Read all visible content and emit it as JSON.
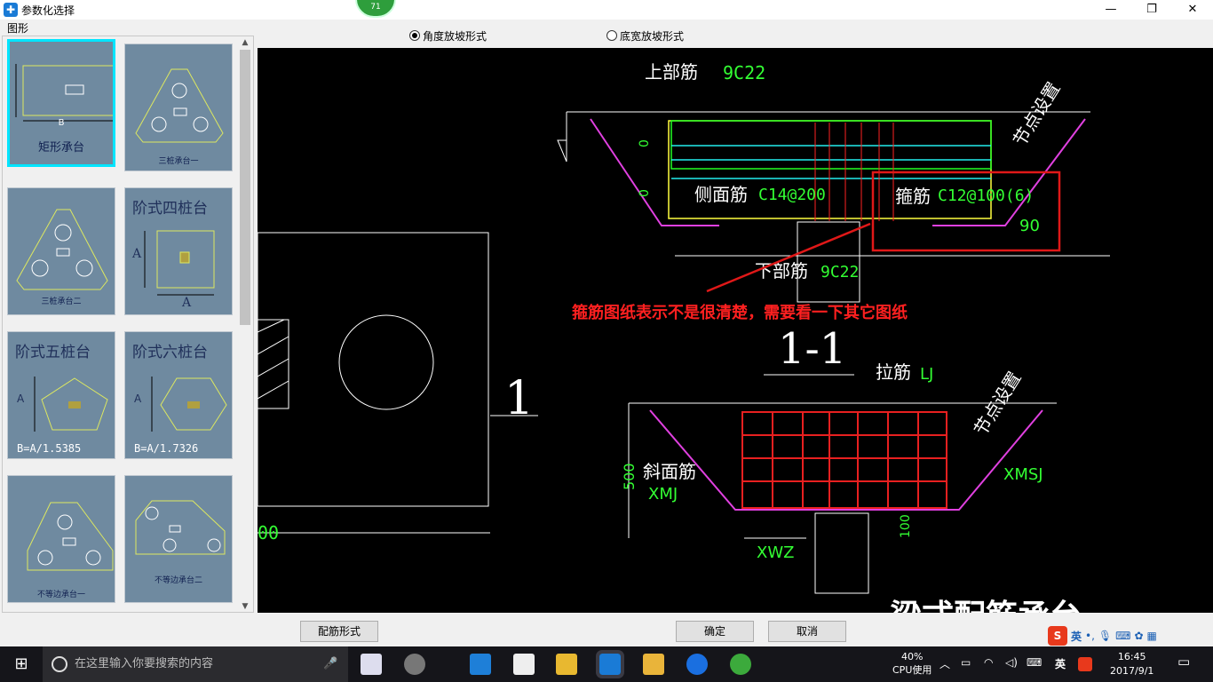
{
  "window": {
    "title": "参数化选择",
    "badge": "71",
    "minimize": "—",
    "maximize": "❐",
    "close": "✕"
  },
  "left_panel": {
    "label": "图形",
    "items": [
      {
        "caption": "矩形承台",
        "dim": "B"
      },
      {
        "caption": "三桩承台一"
      },
      {
        "caption": "三桩承台二"
      },
      {
        "caption": "阶式四桩台",
        "dim": "A",
        "dim2": "A"
      },
      {
        "caption": "阶式五桩台",
        "dim": "A",
        "formula": "B=A/1.5385"
      },
      {
        "caption": "阶式六桩台",
        "dim": "A",
        "formula": "B=A/1.7326"
      },
      {
        "caption": "不等边承台一"
      },
      {
        "caption": "不等边承台二"
      }
    ]
  },
  "radio": {
    "angle": "角度放坡形式",
    "width": "底宽放坡形式",
    "selected": "angle"
  },
  "cad": {
    "top_rebar": "上部筋",
    "top_rebar_val": "9C22",
    "node_setting": "节点设置",
    "side_rebar": "侧面筋",
    "side_rebar_val": "C14@200",
    "stirrup": "箍筋",
    "stirrup_val": "C12@100(6)",
    "angle": "90",
    "bottom_rebar": "下部筋",
    "bottom_rebar_val": "9C22",
    "annotation": "箍筋图纸表示不是很清楚，需要看一下其它图纸",
    "section": "1-1",
    "tie_rebar": "拉筋",
    "tie_rebar_val": "LJ",
    "node_setting2": "节点设置",
    "slope_rebar": "斜面筋",
    "slope_rebar_val": "XMJ",
    "xmsj": "XMSJ",
    "xwz": "XWZ",
    "dim500": "500",
    "dim100": "100",
    "dim_zero1": "0",
    "dim_zero2": "0",
    "left_one": "1",
    "left_00": "00",
    "bottom_title": "梁式配筋承台"
  },
  "buttons": {
    "rebar_form": "配筋形式",
    "ok": "确定",
    "cancel": "取消"
  },
  "ime": {
    "logo": "S",
    "lang": "英"
  },
  "taskbar": {
    "search_placeholder": "在这里输入你要搜索的内容",
    "cpu_pct": "40%",
    "cpu_label": "CPU使用",
    "lang": "英",
    "time": "16:45",
    "date": "2017/9/1"
  }
}
